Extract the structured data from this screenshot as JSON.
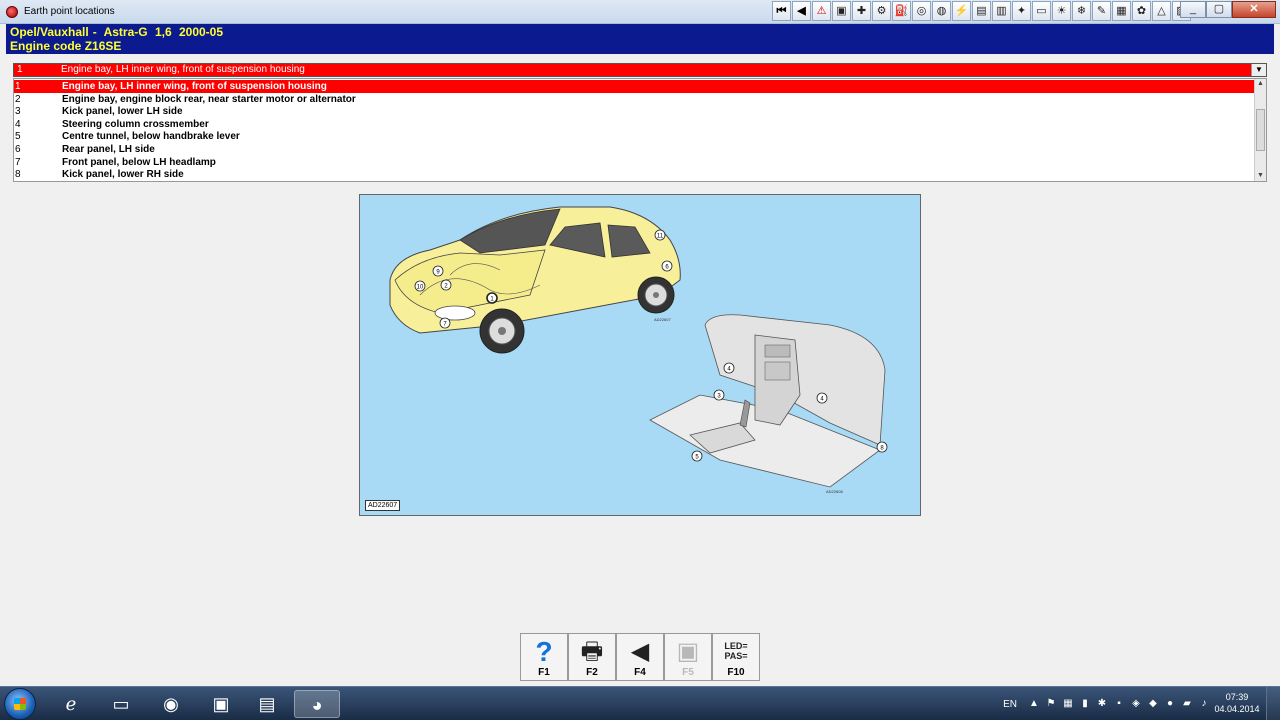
{
  "window": {
    "title": "Earth point locations",
    "minimize": "_",
    "maximize": "▢",
    "close": "✕"
  },
  "toolbar": [
    {
      "name": "first-page-icon",
      "glyph": "⏮"
    },
    {
      "name": "back-icon",
      "glyph": "◀"
    },
    {
      "name": "warning-icon",
      "glyph": "⚠"
    },
    {
      "name": "vehicle-icon",
      "glyph": "▣"
    },
    {
      "name": "service-icon",
      "glyph": "✚"
    },
    {
      "name": "engine-icon",
      "glyph": "⚙"
    },
    {
      "name": "fuel-icon",
      "glyph": "⛽"
    },
    {
      "name": "wheel-icon",
      "glyph": "◎"
    },
    {
      "name": "brake-icon",
      "glyph": "◍"
    },
    {
      "name": "electrical-icon",
      "glyph": "⚡"
    },
    {
      "name": "body-icon",
      "glyph": "▤"
    },
    {
      "name": "door-icon",
      "glyph": "▥"
    },
    {
      "name": "gearbox-icon",
      "glyph": "✦"
    },
    {
      "name": "car-icon",
      "glyph": "▭"
    },
    {
      "name": "light-icon",
      "glyph": "☀"
    },
    {
      "name": "climate-icon",
      "glyph": "❄"
    },
    {
      "name": "key-icon",
      "glyph": "✎"
    },
    {
      "name": "diagram-icon",
      "glyph": "▦"
    },
    {
      "name": "settings-icon",
      "glyph": "✿"
    },
    {
      "name": "alert-icon",
      "glyph": "△"
    },
    {
      "name": "print-icon",
      "glyph": "▨"
    }
  ],
  "header": {
    "make": "Opel/Vauxhall",
    "separator": "-",
    "model": "Astra-G",
    "engine": "1,6",
    "years": "2000-05",
    "engine_code_label": "Engine code",
    "engine_code": "Z16SE"
  },
  "dropdown": {
    "num": "1",
    "label": "Engine bay, LH inner wing, front of suspension housing",
    "arrow": "▼"
  },
  "list": {
    "items": [
      {
        "num": "1",
        "label": "Engine bay, LH inner wing, front of suspension housing"
      },
      {
        "num": "2",
        "label": "Engine bay, engine block rear, near starter motor or alternator"
      },
      {
        "num": "3",
        "label": "Kick panel, lower LH side"
      },
      {
        "num": "4",
        "label": "Steering column crossmember"
      },
      {
        "num": "5",
        "label": "Centre tunnel, below handbrake lever"
      },
      {
        "num": "6",
        "label": "Rear panel, LH side"
      },
      {
        "num": "7",
        "label": "Front panel, below LH headlamp"
      },
      {
        "num": "8",
        "label": "Kick panel, lower RH side"
      }
    ],
    "selected_index": 0,
    "scroll_up": "▲",
    "scroll_down": "▼"
  },
  "diagram": {
    "reference": "AD22607",
    "car_ref": "AD22607",
    "interior_ref": "AD22608",
    "car_markers": [
      "11",
      "9",
      "10",
      "2",
      "1",
      "6",
      "7"
    ],
    "interior_markers": [
      "4",
      "3",
      "4",
      "8",
      "5"
    ],
    "car_color": "#f7ef9a",
    "interior_color": "#e8e8e8",
    "background_color": "#a8d9f5"
  },
  "fkeys": [
    {
      "key": "F1",
      "icon": "?",
      "name": "help-icon",
      "enabled": true
    },
    {
      "key": "F2",
      "icon": "🖶",
      "name": "print-icon",
      "enabled": true
    },
    {
      "key": "F4",
      "icon": "◀",
      "name": "back-icon",
      "enabled": true
    },
    {
      "key": "F5",
      "icon": "▣",
      "name": "component-icon",
      "enabled": false
    },
    {
      "key": "F10",
      "icon": "LED=\nPAS=",
      "name": "led-pas-icon",
      "enabled": true
    }
  ],
  "taskbar": {
    "language": "EN",
    "time": "07:39",
    "date": "04.04.2014"
  }
}
